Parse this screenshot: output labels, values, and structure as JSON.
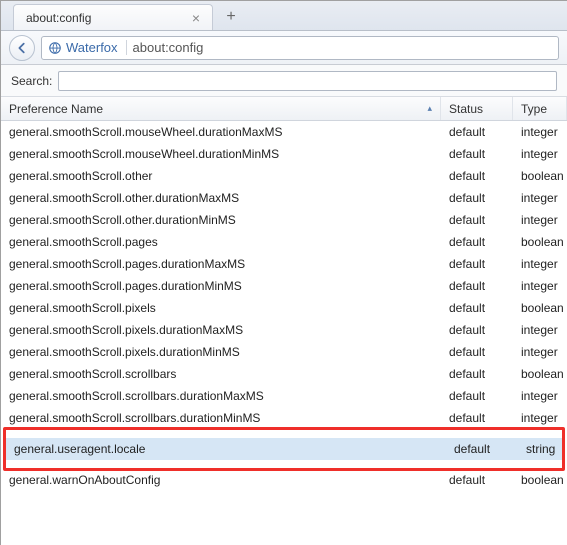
{
  "tab": {
    "title": "about:config"
  },
  "toolbar": {
    "identity_label": "Waterfox",
    "url": "about:config"
  },
  "search": {
    "label": "Search:",
    "value": ""
  },
  "columns": {
    "name": "Preference Name",
    "status": "Status",
    "type": "Type"
  },
  "rows": [
    {
      "name": "general.smoothScroll.mouseWheel.durationMaxMS",
      "status": "default",
      "type": "integer"
    },
    {
      "name": "general.smoothScroll.mouseWheel.durationMinMS",
      "status": "default",
      "type": "integer"
    },
    {
      "name": "general.smoothScroll.other",
      "status": "default",
      "type": "boolean"
    },
    {
      "name": "general.smoothScroll.other.durationMaxMS",
      "status": "default",
      "type": "integer"
    },
    {
      "name": "general.smoothScroll.other.durationMinMS",
      "status": "default",
      "type": "integer"
    },
    {
      "name": "general.smoothScroll.pages",
      "status": "default",
      "type": "boolean"
    },
    {
      "name": "general.smoothScroll.pages.durationMaxMS",
      "status": "default",
      "type": "integer"
    },
    {
      "name": "general.smoothScroll.pages.durationMinMS",
      "status": "default",
      "type": "integer"
    },
    {
      "name": "general.smoothScroll.pixels",
      "status": "default",
      "type": "boolean"
    },
    {
      "name": "general.smoothScroll.pixels.durationMaxMS",
      "status": "default",
      "type": "integer"
    },
    {
      "name": "general.smoothScroll.pixels.durationMinMS",
      "status": "default",
      "type": "integer"
    },
    {
      "name": "general.smoothScroll.scrollbars",
      "status": "default",
      "type": "boolean"
    },
    {
      "name": "general.smoothScroll.scrollbars.durationMaxMS",
      "status": "default",
      "type": "integer"
    },
    {
      "name": "general.smoothScroll.scrollbars.durationMinMS",
      "status": "default",
      "type": "integer"
    }
  ],
  "highlighted_row": {
    "name": "general.useragent.locale",
    "status": "default",
    "type": "string"
  },
  "tail_row": {
    "name": "general.warnOnAboutConfig",
    "status": "default",
    "type": "boolean"
  }
}
